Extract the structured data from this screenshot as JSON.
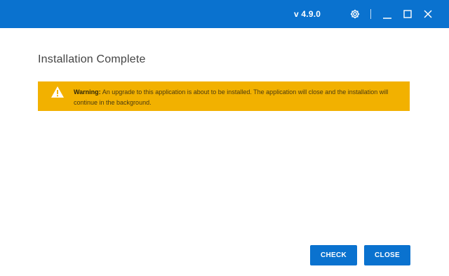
{
  "titlebar": {
    "version": "v 4.9.0",
    "icons": {
      "settings": "gear-icon",
      "minimize": "minimize-icon",
      "maximize": "maximize-icon",
      "close": "close-icon"
    },
    "color": "#0a72cf"
  },
  "main": {
    "title": "Installation Complete",
    "warning": {
      "label": "Warning:",
      "message": "An upgrade to this application is about to be installed. The application will close and the installation will continue in the background.",
      "icon": "warning-triangle-icon",
      "color": "#f2b100"
    }
  },
  "actions": {
    "check_label": "CHECK",
    "close_label": "CLOSE",
    "color": "#0a72cf"
  }
}
